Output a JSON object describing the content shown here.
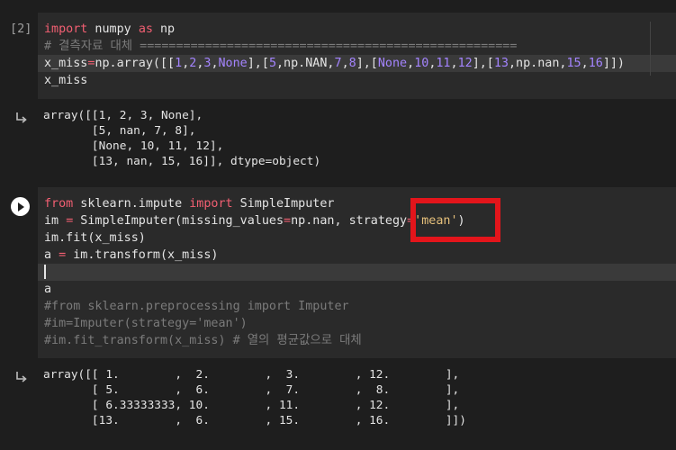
{
  "cell1": {
    "prompt": "[2]",
    "lines": [
      [
        {
          "t": "import",
          "c": "kw"
        },
        {
          "t": " numpy ",
          "c": "plain"
        },
        {
          "t": "as",
          "c": "kw"
        },
        {
          "t": " np",
          "c": "plain"
        }
      ],
      [
        {
          "t": "# 결측자료 대체 ====================================================",
          "c": "cm"
        }
      ],
      [
        {
          "t": "x_miss",
          "c": "plain"
        },
        {
          "t": "=",
          "c": "op"
        },
        {
          "t": "np.array([[",
          "c": "plain"
        },
        {
          "t": "1",
          "c": "num"
        },
        {
          "t": ",",
          "c": "plain"
        },
        {
          "t": "2",
          "c": "num"
        },
        {
          "t": ",",
          "c": "plain"
        },
        {
          "t": "3",
          "c": "num"
        },
        {
          "t": ",",
          "c": "plain"
        },
        {
          "t": "None",
          "c": "num"
        },
        {
          "t": "],[",
          "c": "plain"
        },
        {
          "t": "5",
          "c": "num"
        },
        {
          "t": ",np.NAN,",
          "c": "plain"
        },
        {
          "t": "7",
          "c": "num"
        },
        {
          "t": ",",
          "c": "plain"
        },
        {
          "t": "8",
          "c": "num"
        },
        {
          "t": "],[",
          "c": "plain"
        },
        {
          "t": "None",
          "c": "num"
        },
        {
          "t": ",",
          "c": "plain"
        },
        {
          "t": "10",
          "c": "num"
        },
        {
          "t": ",",
          "c": "plain"
        },
        {
          "t": "11",
          "c": "num"
        },
        {
          "t": ",",
          "c": "plain"
        },
        {
          "t": "12",
          "c": "num"
        },
        {
          "t": "],[",
          "c": "plain"
        },
        {
          "t": "13",
          "c": "num"
        },
        {
          "t": ",np.nan,",
          "c": "plain"
        },
        {
          "t": "15",
          "c": "num"
        },
        {
          "t": ",",
          "c": "plain"
        },
        {
          "t": "16",
          "c": "num"
        },
        {
          "t": "]])",
          "c": "plain"
        }
      ],
      [
        {
          "t": "x_miss",
          "c": "plain"
        }
      ]
    ]
  },
  "output1": {
    "text": "array([[1, 2, 3, None],\n       [5, nan, 7, 8],\n       [None, 10, 11, 12],\n       [13, nan, 15, 16]], dtype=object)"
  },
  "cell2": {
    "lines": [
      [
        {
          "t": "from",
          "c": "kw"
        },
        {
          "t": " sklearn.impute ",
          "c": "plain"
        },
        {
          "t": "import",
          "c": "kw"
        },
        {
          "t": " SimpleImputer",
          "c": "plain"
        }
      ],
      [
        {
          "t": "im ",
          "c": "plain"
        },
        {
          "t": "=",
          "c": "op"
        },
        {
          "t": " SimpleImputer(missing_values",
          "c": "plain"
        },
        {
          "t": "=",
          "c": "op"
        },
        {
          "t": "np.nan, strategy",
          "c": "plain"
        },
        {
          "t": "=",
          "c": "op"
        },
        {
          "t": "'mean'",
          "c": "str"
        },
        {
          "t": ")",
          "c": "plain"
        }
      ],
      [
        {
          "t": "im.fit(x_miss)",
          "c": "plain"
        }
      ],
      [
        {
          "t": "a ",
          "c": "plain"
        },
        {
          "t": "=",
          "c": "op"
        },
        {
          "t": " im.transform(x_miss)",
          "c": "plain"
        }
      ],
      [],
      [
        {
          "t": "a",
          "c": "plain"
        }
      ],
      [
        {
          "t": "#from sklearn.preprocessing import Imputer",
          "c": "cm"
        }
      ],
      [
        {
          "t": "#im=Imputer(strategy='mean')",
          "c": "cm"
        }
      ],
      [
        {
          "t": "#im.fit_transform(x_miss) # 열의 평균값으로 대체",
          "c": "cm"
        }
      ]
    ]
  },
  "output2": {
    "text": "array([[ 1.        ,  2.        ,  3.        , 12.        ],\n       [ 5.        ,  6.        ,  7.        ,  8.        ],\n       [ 6.33333333, 10.        , 11.        , 12.        ],\n       [13.        ,  6.        , 15.        , 16.        ]])"
  }
}
